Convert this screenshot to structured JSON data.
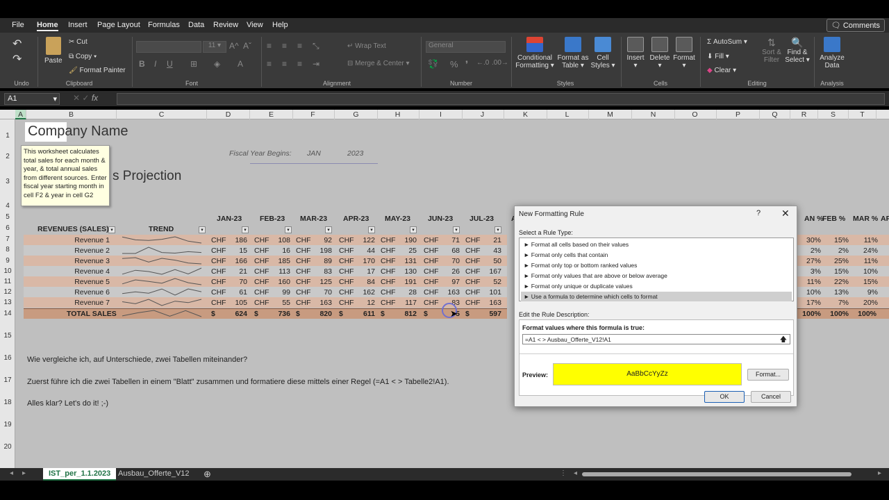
{
  "menu": [
    "File",
    "Home",
    "Insert",
    "Page Layout",
    "Formulas",
    "Data",
    "Review",
    "View",
    "Help"
  ],
  "active_menu": "Home",
  "comments": "Comments",
  "ribbon": {
    "undo": "Undo",
    "clipboard": {
      "paste": "Paste",
      "cut": "Cut",
      "copy": "Copy",
      "format_painter": "Format Painter",
      "group": "Clipboard"
    },
    "font": {
      "size": "11",
      "group": "Font"
    },
    "alignment": {
      "wrap": "Wrap Text",
      "merge": "Merge & Center",
      "group": "Alignment"
    },
    "number": {
      "format": "General",
      "group": "Number"
    },
    "styles": {
      "conditional": "Conditional",
      "conditional2": "Formatting",
      "format_table": "Format as",
      "format_table2": "Table",
      "cell_styles": "Cell",
      "cell_styles2": "Styles",
      "group": "Styles"
    },
    "cells": {
      "insert": "Insert",
      "delete": "Delete",
      "format": "Format",
      "group": "Cells"
    },
    "editing": {
      "autosum": "AutoSum",
      "fill": "Fill",
      "clear": "Clear",
      "sort": "Sort &",
      "sort2": "Filter",
      "find": "Find &",
      "find2": "Select",
      "group": "Editing"
    },
    "analysis": {
      "analyze": "Analyze",
      "analyze2": "Data",
      "group": "Analysis"
    }
  },
  "namebox": "A1",
  "fx": "fx",
  "columns": [
    "A",
    "B",
    "C",
    "D",
    "E",
    "F",
    "G",
    "H",
    "I",
    "J",
    "K",
    "L",
    "M",
    "N",
    "O",
    "P",
    "Q",
    "R",
    "S",
    "T"
  ],
  "rows": [
    "1",
    "2",
    "3",
    "4",
    "5",
    "6",
    "7",
    "8",
    "9",
    "10",
    "11",
    "12",
    "13",
    "14",
    "15",
    "16",
    "17",
    "18",
    "19",
    "20"
  ],
  "sheet": {
    "company": "Company Name",
    "projection": "s Projection",
    "fiscal_label": "Fiscal Year Begins:",
    "fiscal_month": "JAN",
    "fiscal_year": "2023",
    "note": "This worksheet calculates total sales for each month & year, & total annual sales from different sources. Enter fiscal year starting month in cell F2 & year in cell G2",
    "revenues_header": "REVENUES (SALES)",
    "trend_header": "TREND",
    "months": [
      "JAN-23",
      "FEB-23",
      "MAR-23",
      "APR-23",
      "MAY-23",
      "JUN-23",
      "JUL-23",
      "A"
    ],
    "pct_headers": [
      "AN %",
      "FEB %",
      "MAR %",
      "AP"
    ],
    "currency": "CHF",
    "dollar": "$",
    "revenue_rows": [
      {
        "label": "Revenue 1",
        "values": [
          "186",
          "108",
          "92",
          "122",
          "190",
          "71",
          "21"
        ],
        "pct": [
          "30%",
          "15%",
          "11%"
        ]
      },
      {
        "label": "Revenue 2",
        "values": [
          "15",
          "16",
          "198",
          "44",
          "25",
          "68",
          "43"
        ],
        "pct": [
          "2%",
          "2%",
          "24%"
        ]
      },
      {
        "label": "Revenue 3",
        "values": [
          "166",
          "185",
          "89",
          "170",
          "131",
          "70",
          "50"
        ],
        "pct": [
          "27%",
          "25%",
          "11%"
        ]
      },
      {
        "label": "Revenue 4",
        "values": [
          "21",
          "113",
          "83",
          "17",
          "130",
          "26",
          "167"
        ],
        "pct": [
          "3%",
          "15%",
          "10%"
        ]
      },
      {
        "label": "Revenue 5",
        "values": [
          "70",
          "160",
          "125",
          "84",
          "191",
          "97",
          "52"
        ],
        "pct": [
          "11%",
          "22%",
          "15%"
        ]
      },
      {
        "label": "Revenue 6",
        "values": [
          "61",
          "99",
          "70",
          "162",
          "28",
          "163",
          "101"
        ],
        "pct": [
          "10%",
          "13%",
          "9%"
        ]
      },
      {
        "label": "Revenue 7",
        "values": [
          "105",
          "55",
          "163",
          "12",
          "117",
          "83",
          "163"
        ],
        "pct": [
          "17%",
          "7%",
          "20%"
        ]
      }
    ],
    "total_label": "TOTAL SALES",
    "totals": [
      "624",
      "736",
      "820",
      "611",
      "812",
      "5",
      "597"
    ],
    "total_pct": [
      "100%",
      "100%",
      "100%"
    ],
    "line16": "Wie vergleiche ich, auf Unterschiede, zwei Tabellen miteinander?",
    "line17": "Zuerst führe ich die zwei Tabellen in einem \"Blatt\" zusammen und formatiere diese mittels einer Regel (=A1 < > Tabelle2!A1).",
    "line18": "Alles klar? Let's do it! ;-)"
  },
  "tabs": [
    "IST_per_1.1.2023",
    "Ausbau_Offerte_V12"
  ],
  "dialog": {
    "title": "New Formatting Rule",
    "help": "?",
    "close": "✕",
    "select_label": "Select a Rule Type:",
    "rules": [
      "► Format all cells based on their values",
      "► Format only cells that contain",
      "► Format only top or bottom ranked values",
      "► Format only values that are above or below average",
      "► Format only unique or duplicate values",
      "► Use a formula to determine which cells to format"
    ],
    "edit_label": "Edit the Rule Description:",
    "formula_label": "Format values where this formula is true:",
    "formula": "=A1 < > Ausbau_Offerte_V12!A1",
    "preview_label": "Preview:",
    "preview_text": "AaBbCcYyZz",
    "format_btn": "Format...",
    "ok": "OK",
    "cancel": "Cancel"
  },
  "colors": {
    "preview_bg": "#ffff00",
    "band_light": "#d9b8a6",
    "band_dark": "#c89b80",
    "excel_green": "#217346",
    "note_bg": "#ffffe1"
  }
}
